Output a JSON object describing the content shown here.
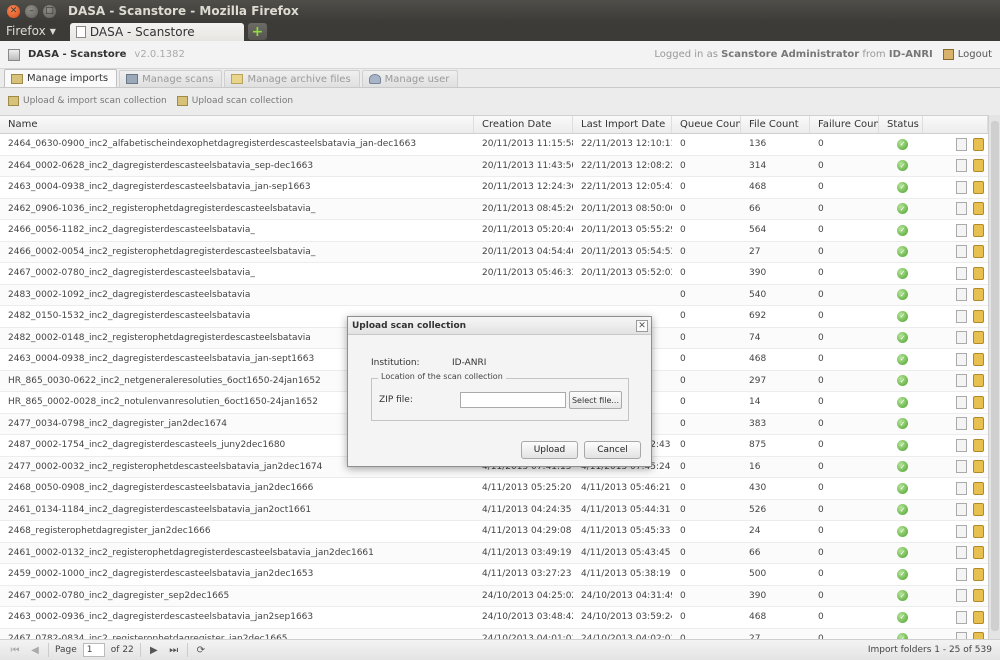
{
  "window": {
    "title": "DASA - Scanstore - Mozilla Firefox"
  },
  "browser": {
    "menu_label": "Firefox",
    "tab_title": "DASA - Scanstore",
    "new_tab_symbol": "+"
  },
  "app": {
    "name": "DASA - Scanstore",
    "version": "v2.0.1382",
    "logged_prefix": "Logged in as",
    "user": "Scanstore Administrator",
    "from_word": "from",
    "institution": "ID-ANRI",
    "logout_label": "Logout"
  },
  "tabs": [
    {
      "label": "Manage imports",
      "icon": "box-icon",
      "active": true
    },
    {
      "label": "Manage scans",
      "icon": "scanner-icon",
      "active": false
    },
    {
      "label": "Manage archive files",
      "icon": "folder-icon",
      "active": false
    },
    {
      "label": "Manage user",
      "icon": "user-icon",
      "active": false
    }
  ],
  "toolbar": {
    "upload_import_label": "Upload & import scan collection",
    "upload_label": "Upload scan collection"
  },
  "grid": {
    "columns": [
      "Name",
      "Creation Date",
      "Last Import Date",
      "Queue Count",
      "File Count",
      "Failure Count",
      "Status",
      ""
    ],
    "rows": [
      [
        "2464_0630-0900_inc2_alfabetischeindexophetdagregisterdescasteelsbatavia_jan-dec1663",
        "20/11/2013 11:15:58",
        "22/11/2013 12:10:11",
        "0",
        "136",
        "0"
      ],
      [
        "2464_0002-0628_inc2_dagregisterdescasteelsbatavia_sep-dec1663",
        "20/11/2013 11:43:56",
        "22/11/2013 12:08:22",
        "0",
        "314",
        "0"
      ],
      [
        "2463_0004-0938_inc2_dagregisterdescasteelsbatavia_jan-sep1663",
        "20/11/2013 12:24:36",
        "22/11/2013 12:05:43",
        "0",
        "468",
        "0"
      ],
      [
        "2462_0906-1036_inc2_registerophetdagregisterdescasteelsbatavia_",
        "20/11/2013 08:45:26",
        "20/11/2013 08:50:06",
        "0",
        "66",
        "0"
      ],
      [
        "2466_0056-1182_inc2_dagregisterdescasteelsbatavia_",
        "20/11/2013 05:20:46",
        "20/11/2013 05:55:29",
        "0",
        "564",
        "0"
      ],
      [
        "2466_0002-0054_inc2_registerophetdagregisterdescasteelsbatavia_",
        "20/11/2013 04:54:40",
        "20/11/2013 05:54:53",
        "0",
        "27",
        "0"
      ],
      [
        "2467_0002-0780_inc2_dagregisterdescasteelsbatavia_",
        "20/11/2013 05:46:33",
        "20/11/2013 05:52:03",
        "0",
        "390",
        "0"
      ],
      [
        "2483_0002-1092_inc2_dagregisterdescasteelsbatavia",
        "",
        "",
        "0",
        "540",
        "0"
      ],
      [
        "2482_0150-1532_inc2_dagregisterdescasteelsbatavia",
        "",
        "",
        "0",
        "692",
        "0"
      ],
      [
        "2482_0002-0148_inc2_registerophetdagregisterdescasteelsbatavia",
        "",
        "",
        "0",
        "74",
        "0"
      ],
      [
        "2463_0004-0938_inc2_dagregisterdescasteelsbatavia_jan-sept1663",
        "",
        "",
        "0",
        "468",
        "0"
      ],
      [
        "HR_865_0030-0622_inc2_netgeneraleresoluties_6oct1650-24jan1652",
        "",
        "",
        "0",
        "297",
        "0"
      ],
      [
        "HR_865_0002-0028_inc2_notulenvanresolutien_6oct1650-24jan1652",
        "",
        "",
        "0",
        "14",
        "0"
      ],
      [
        "2477_0034-0798_inc2_dagregister_jan2dec1674",
        "",
        "",
        "0",
        "383",
        "0"
      ],
      [
        "2487_0002-1754_inc2_dagregisterdescasteels_juny2dec1680",
        "4/11/2013 07:00:32",
        "4/11/2013 07:42:43",
        "0",
        "875",
        "0"
      ],
      [
        "2477_0002-0032_inc2_registerophetdescasteelsbatavia_jan2dec1674",
        "4/11/2013 07:41:15",
        "4/11/2013 07:45:24",
        "0",
        "16",
        "0"
      ],
      [
        "2468_0050-0908_inc2_dagregisterdescasteelsbatavia_jan2dec1666",
        "4/11/2013 05:25:20",
        "4/11/2013 05:46:21",
        "0",
        "430",
        "0"
      ],
      [
        "2461_0134-1184_inc2_dagregisterdescasteelsbatavia_jan2oct1661",
        "4/11/2013 04:24:35",
        "4/11/2013 05:44:31",
        "0",
        "526",
        "0"
      ],
      [
        "2468_registerophetdagregister_jan2dec1666",
        "4/11/2013 04:29:08",
        "4/11/2013 05:45:33",
        "0",
        "24",
        "0"
      ],
      [
        "2461_0002-0132_inc2_registerophetdagregisterdescasteelsbatavia_jan2dec1661",
        "4/11/2013 03:49:19",
        "4/11/2013 05:43:45",
        "0",
        "66",
        "0"
      ],
      [
        "2459_0002-1000_inc2_dagregisterdescasteelsbatavia_jan2dec1653",
        "4/11/2013 03:27:23",
        "4/11/2013 05:38:19",
        "0",
        "500",
        "0"
      ],
      [
        "2467_0002-0780_inc2_dagregister_sep2dec1665",
        "24/10/2013 04:25:02",
        "24/10/2013 04:31:49",
        "0",
        "390",
        "0"
      ],
      [
        "2463_0002-0936_inc2_dagregisterdescasteelsbatavia_jan2sep1663",
        "24/10/2013 03:48:42",
        "24/10/2013 03:59:24",
        "0",
        "468",
        "0"
      ],
      [
        "2467_0782-0834_inc2_registerophetdagregister_jan2dec1665",
        "24/10/2013 04:01:01",
        "24/10/2013 04:02:01",
        "0",
        "27",
        "0"
      ]
    ]
  },
  "pager": {
    "page_label": "Page",
    "page_value": "1",
    "of_label": "of 22",
    "info": "Import folders 1 - 25 of 539"
  },
  "dialog": {
    "title": "Upload scan collection",
    "institution_label": "Institution:",
    "institution_value": "ID-ANRI",
    "legend": "Location of the scan collection",
    "zip_label": "ZIP file:",
    "select_label": "Select file...",
    "upload_label": "Upload",
    "cancel_label": "Cancel"
  },
  "colors": {
    "status_ok": "#4aa12a",
    "titlebar": "#3c3b37",
    "close_button": "#dd4814"
  }
}
